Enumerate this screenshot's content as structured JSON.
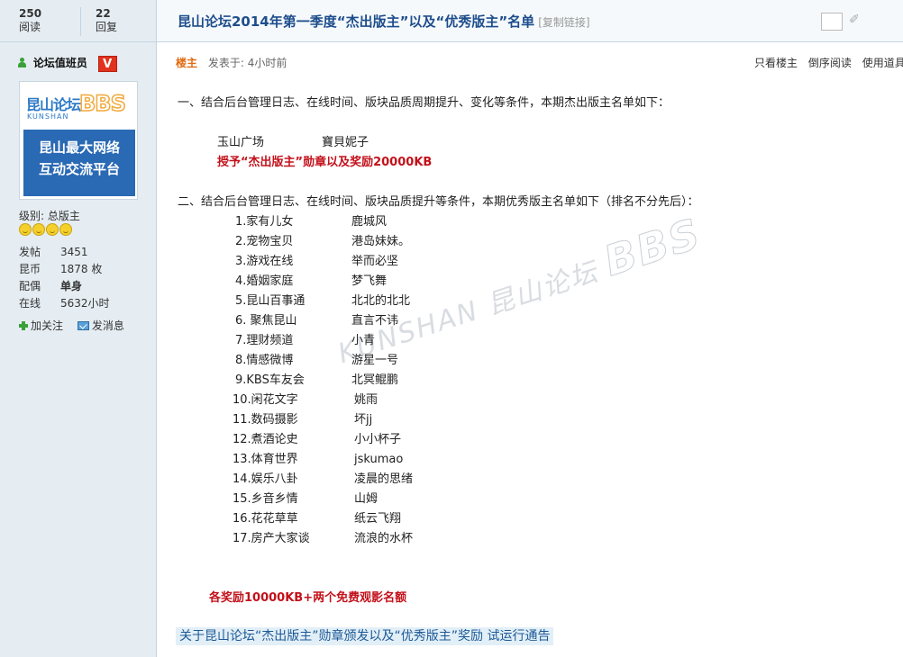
{
  "stats": {
    "reads_num": "250",
    "reads_label": "阅读",
    "replies_num": "22",
    "replies_label": "回复"
  },
  "thread": {
    "title": "昆山论坛2014年第一季度“杰出版主”以及“优秀版主”名单",
    "copy_link": "[复制链接]"
  },
  "author": {
    "name": "论坛值班员",
    "badge": "V",
    "avatar": {
      "logo_cn": "昆山论坛",
      "logo_en": "KUNSHAN",
      "logo_bbs": "BBS",
      "slogan_line1": "昆山最大网络",
      "slogan_line2": "互动交流平台"
    },
    "level": "级别: 总版主",
    "profile": [
      {
        "label": "发帖",
        "value": "3451"
      },
      {
        "label": "昆币",
        "value": "1878 枚"
      },
      {
        "label": "配偶",
        "value": "单身"
      },
      {
        "label": "在线",
        "value": "5632小时"
      }
    ],
    "actions": {
      "follow": "加关注",
      "message": "发消息"
    }
  },
  "post": {
    "floor": "楼主",
    "posted_at": "发表于: 4小时前",
    "tools": [
      "只看楼主",
      "倒序阅读",
      "使用道具"
    ],
    "para1": "一、结合后台管理日志、在线时间、版块品质周期提升、变化等条件，本期杰出版主名单如下：",
    "outstanding_board": "玉山广场",
    "outstanding_name": "寶貝妮子",
    "award1": "授予“杰出版主”勋章以及奖励20000KB",
    "para2": "二、结合后台管理日志、在线时间、版块品质提升等条件，本期优秀版主名单如下（排名不分先后）：",
    "excellent": [
      {
        "board": "1.家有儿女",
        "name": "鹿城风"
      },
      {
        "board": "2.宠物宝贝",
        "name": "港岛妹妹。"
      },
      {
        "board": "3.游戏在线",
        "name": "举而必坚"
      },
      {
        "board": "4.婚姻家庭",
        "name": "梦飞舞"
      },
      {
        "board": "5.昆山百事通",
        "name": "北北的北北"
      },
      {
        "board": "6. 聚焦昆山",
        "name": "直言不讳"
      },
      {
        "board": "7.理财频道",
        "name": "小青"
      },
      {
        "board": "8.情感微博",
        "name": "游星一号"
      },
      {
        "board": "9.KBS车友会",
        "name": "北冥鲲鹏"
      },
      {
        "board": "10.闲花文字",
        "name": "姚雨"
      },
      {
        "board": "11.数码摄影",
        "name": "坏jj"
      },
      {
        "board": "12.煮酒论史",
        "name": "小小杯子"
      },
      {
        "board": "13.体育世界",
        "name": "jskumao"
      },
      {
        "board": "14.娱乐八卦",
        "name": "凌晨的思绪"
      },
      {
        "board": "15.乡音乡情",
        "name": "山姆"
      },
      {
        "board": "16.花花草草",
        "name": "纸云飞翔"
      },
      {
        "board": "17.房产大家谈",
        "name": "流浪的水杯"
      }
    ],
    "award2": "各奖励10000KB+两个免费观影名额",
    "link": "关于昆山论坛“杰出版主”勋章颁发以及“优秀版主”奖励 试运行通告",
    "watermark_cn": "昆山论坛",
    "watermark_en": "KUNSHAN",
    "watermark_bbs": "BBS"
  }
}
